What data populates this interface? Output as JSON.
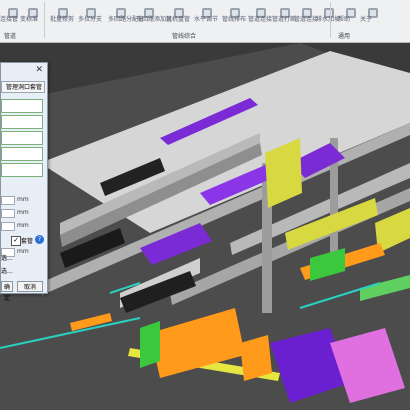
{
  "ribbon": {
    "tools": [
      {
        "label": "连接管",
        "icon": "pipe-connect-icon"
      },
      {
        "label": "变标准",
        "icon": "standard-icon"
      },
      {
        "label": "批量修剪",
        "icon": "trim-icon"
      },
      {
        "label": "多拉分支",
        "icon": "branch-icon"
      },
      {
        "label": "多回路分配管",
        "icon": "multi-loop-icon"
      },
      {
        "label": "多回路添加管",
        "icon": "add-loop-icon"
      },
      {
        "label": "风机盘管",
        "icon": "fan-coil-icon"
      },
      {
        "label": "水平调节",
        "icon": "level-icon"
      },
      {
        "label": "管线排布",
        "icon": "layout-icon"
      },
      {
        "label": "管道连接",
        "icon": "pipe-link-icon"
      },
      {
        "label": "管道打断",
        "icon": "pipe-break-icon"
      },
      {
        "label": "管道连接",
        "icon": "pipe-join-icon"
      },
      {
        "label": "排水加坡",
        "icon": "slope-icon"
      },
      {
        "label": "帮助",
        "icon": "help-icon"
      },
      {
        "label": "关于",
        "icon": "about-icon"
      }
    ],
    "groups": {
      "left": "管道",
      "middle": "管线综合",
      "right": "通用"
    }
  },
  "panel": {
    "tab_label": "管理洞口套管",
    "units": [
      "mm",
      "mm",
      "mm",
      "mm"
    ],
    "checkbox_label": "套管",
    "checkbox_checked": true,
    "small_labels": [
      "选...",
      "选..."
    ],
    "ok_label": "确定",
    "cancel_label": "取消"
  },
  "colors": {
    "purple": "#7a2bd6",
    "yellow": "#d8d840",
    "orange": "#ff9a1a",
    "green": "#3cc83c",
    "teal": "#2ad0c0",
    "magenta": "#e070e0",
    "wall": "#b9b9b9",
    "floor": "#4c4c4c"
  }
}
